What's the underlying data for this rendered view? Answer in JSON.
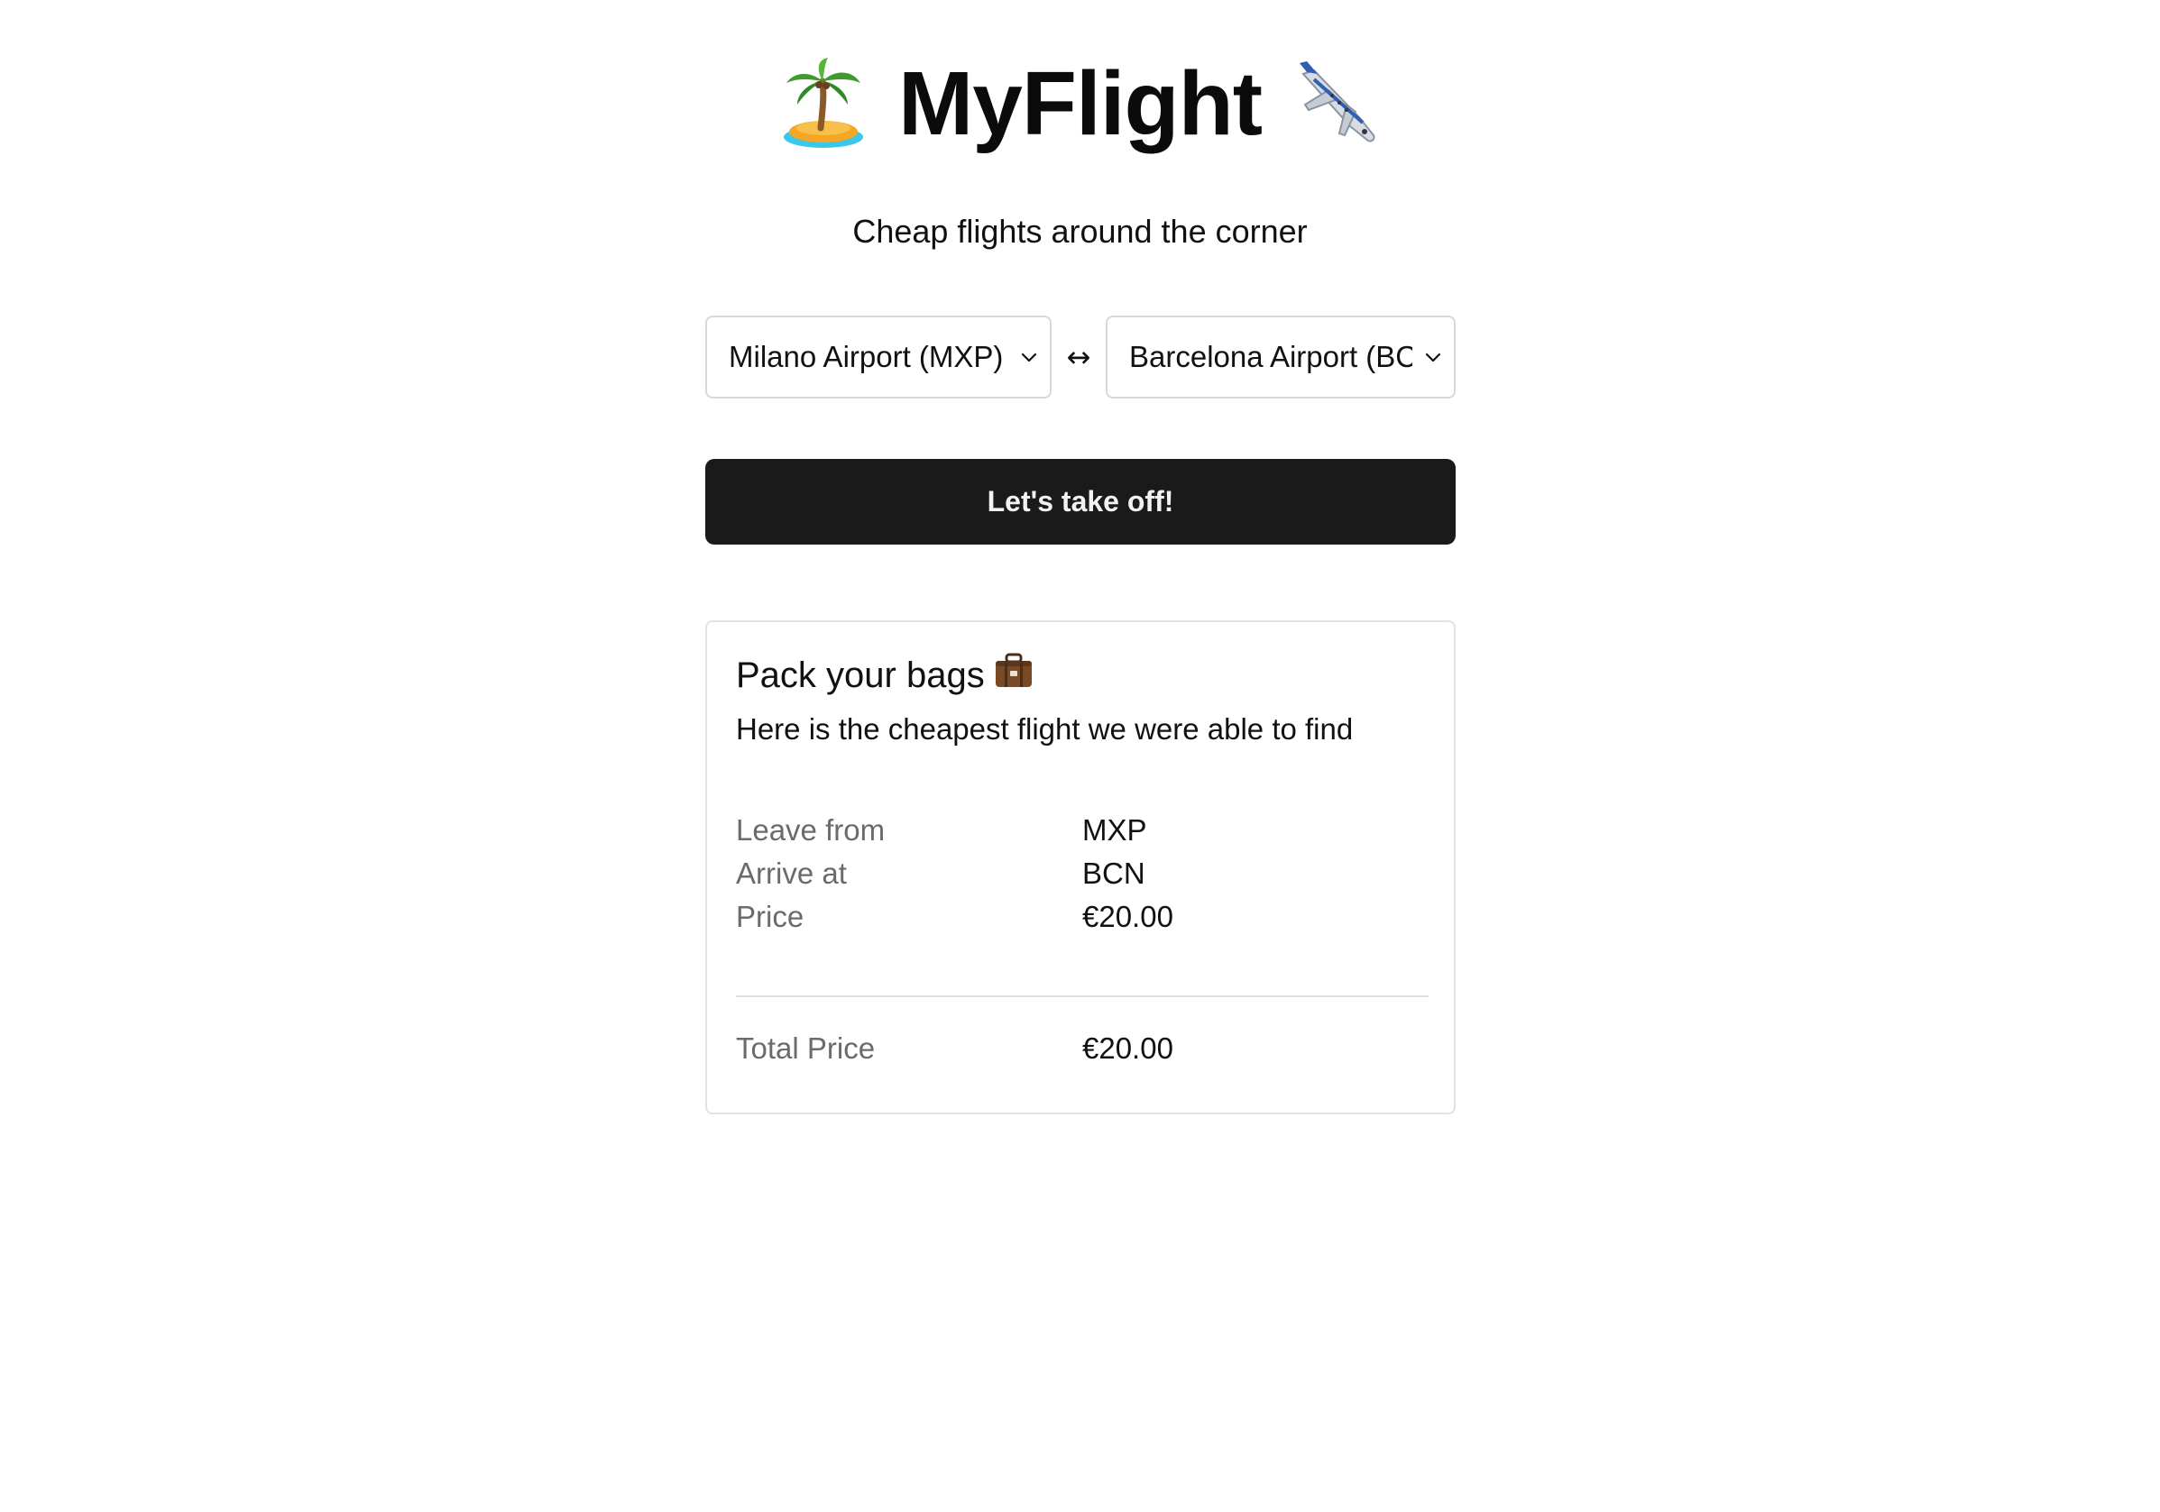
{
  "app": {
    "title": "MyFlight",
    "subtitle": "Cheap flights around the corner",
    "title_left_icon": "palm-island-icon",
    "title_right_icon": "airplane-icon"
  },
  "search": {
    "from_selected": "Milano Airport (MXP)",
    "to_selected": "Barcelona Airport (BC",
    "swap_icon": "↔",
    "submit_label": "Let's take off!"
  },
  "result": {
    "title": "Pack your bags",
    "title_icon": "suitcase-icon",
    "subtitle": "Here is the cheapest flight we were able to find",
    "leave_from_label": "Leave from",
    "leave_from_value": "MXP",
    "arrive_at_label": "Arrive at",
    "arrive_at_value": "BCN",
    "price_label": "Price",
    "price_value": "€20.00",
    "total_label": "Total Price",
    "total_value": "€20.00"
  },
  "colors": {
    "button_bg": "#1a1a1a",
    "button_text": "#f2f2f2",
    "border": "#d8d8d8",
    "muted_text": "#6b6b6b"
  }
}
